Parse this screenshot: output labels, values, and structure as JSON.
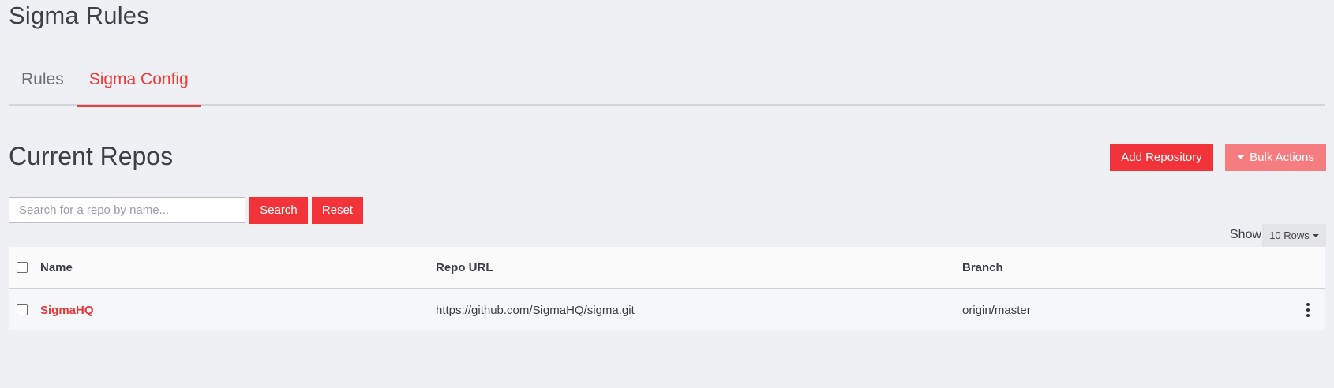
{
  "page": {
    "title": "Sigma Rules"
  },
  "tabs": [
    {
      "label": "Rules",
      "active": false
    },
    {
      "label": "Sigma Config",
      "active": true
    }
  ],
  "section": {
    "title": "Current Repos"
  },
  "actions": {
    "add_repository": "Add Repository",
    "bulk_actions": "Bulk Actions"
  },
  "search": {
    "placeholder": "Search for a repo by name...",
    "value": "",
    "search_label": "Search",
    "reset_label": "Reset"
  },
  "pagination": {
    "show_label": "Show",
    "rows_option": "10 Rows"
  },
  "table": {
    "columns": [
      "Name",
      "Repo URL",
      "Branch"
    ],
    "rows": [
      {
        "name": "SigmaHQ",
        "url": "https://github.com/SigmaHQ/sigma.git",
        "branch": "origin/master"
      }
    ]
  },
  "colors": {
    "accent": "#f2343a",
    "accent_light": "#f57d80",
    "background": "#eff0f4"
  },
  "icons": {
    "caret": "caret-down-icon",
    "row_menu": "kebab-menu-icon"
  }
}
